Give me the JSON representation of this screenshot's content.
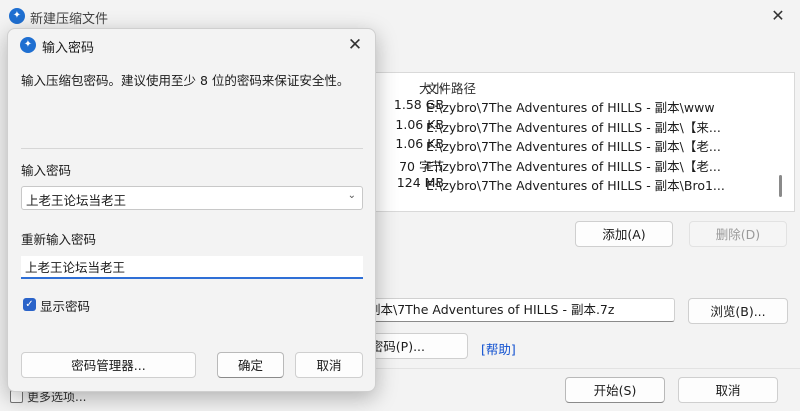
{
  "main": {
    "title": "新建压缩文件",
    "close_glyph": "✕",
    "file_list": {
      "header_size": "大小",
      "header_path": "文件路径",
      "rows": [
        {
          "size": "1.58 GB",
          "path": "E:\\zybro\\7The Adventures of HILLS - 副本\\www"
        },
        {
          "size": "1.06 KB",
          "path": "E:\\zybro\\7The Adventures of HILLS - 副本\\【来..."
        },
        {
          "size": "1.06 KB",
          "path": "E:\\zybro\\7The Adventures of HILLS - 副本\\【老..."
        },
        {
          "size": "70 字节",
          "path": "E:\\zybro\\7The Adventures of HILLS - 副本\\【老..."
        },
        {
          "size": "124 MB",
          "path": "E:\\zybro\\7The Adventures of HILLS - 副本\\Bro1..."
        }
      ]
    },
    "add_label": "添加(A)",
    "remove_label": "删除(D)",
    "archive_path": "副本\\7The Adventures of HILLS - 副本.7z",
    "browse_label": "浏览(B)...",
    "password_button_label": "密码(P)...",
    "help_label": "[帮助]",
    "start_label": "开始(S)",
    "cancel_label": "取消",
    "more_options_label": "更多选项..."
  },
  "dialog": {
    "title": "输入密码",
    "close_glyph": "✕",
    "description": "输入压缩包密码。建议使用至少 8 位的密码来保证安全性。",
    "password_label": "输入密码",
    "password_value": "上老王论坛当老王",
    "confirm_label": "重新输入密码",
    "confirm_value": "上老王论坛当老王",
    "show_password_label": "显示密码",
    "show_password_checked": true,
    "manager_label": "密码管理器...",
    "ok_label": "确定",
    "cancel_label": "取消"
  },
  "icons": {
    "app": "app-logo-icon",
    "check": "check-icon",
    "chevron": "chevron-down-icon"
  },
  "colors": {
    "accent": "#2a63c9",
    "link": "#1050d0",
    "window_bg": "#f3f3f3"
  }
}
